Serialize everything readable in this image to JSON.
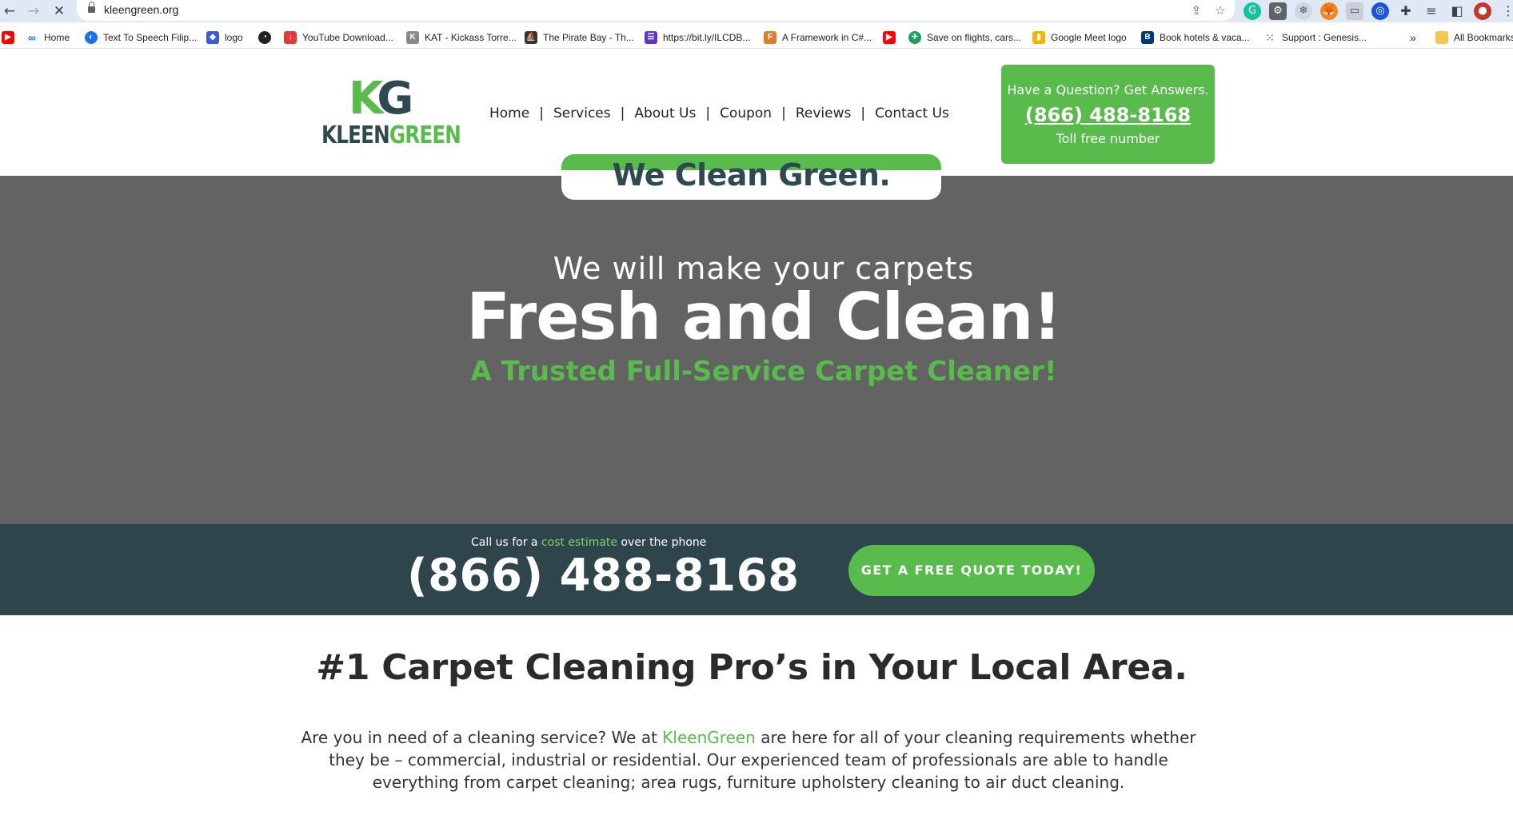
{
  "browser": {
    "url": "kleengreen.org",
    "bookmarks": [
      {
        "label": "Home",
        "icon": "meta-icon",
        "color": "#1877f2"
      },
      {
        "label": "Text To Speech Filip...",
        "icon": "tts-icon",
        "color": "#1a73e8"
      },
      {
        "label": "logo",
        "icon": "shield-logo-icon",
        "color": "#3b5bdb"
      },
      {
        "label": "",
        "icon": "globe-icon",
        "color": "#202124"
      },
      {
        "label": "YouTube Download...",
        "icon": "download-icon",
        "color": "#e53935"
      },
      {
        "label": "KAT - Kickass Torre...",
        "icon": "kat-icon",
        "color": "#6d6d6d"
      },
      {
        "label": "The Pirate Bay - Th...",
        "icon": "pirate-ship-icon",
        "color": "#333333"
      },
      {
        "label": "https://bit.ly/ILCDB...",
        "icon": "list-icon",
        "color": "#5c35cc"
      },
      {
        "label": "A Framework in C#...",
        "icon": "framework-icon",
        "color": "#d9822b"
      },
      {
        "label": "",
        "icon": "youtube-icon",
        "color": "#ff0000"
      },
      {
        "label": "Save on flights, cars...",
        "icon": "plane-icon",
        "color": "#1e9e57"
      },
      {
        "label": "Google Meet logo",
        "icon": "meet-icon",
        "color": "#f4b400"
      },
      {
        "label": "Book hotels & vaca...",
        "icon": "booking-icon",
        "color": "#003580"
      },
      {
        "label": "Support : Genesis...",
        "icon": "dots-grid-icon",
        "color": "#888888"
      }
    ],
    "all_bookmarks_label": "All Bookmarks",
    "more_chevron": "»"
  },
  "header": {
    "logo_monogram_k": "K",
    "logo_monogram_g": "G",
    "logo_word_kleen": "KLEEN",
    "logo_word_green": "GREEN",
    "nav": [
      "Home",
      "Services",
      "About Us",
      "Coupon",
      "Reviews",
      "Contact Us"
    ],
    "nav_separator": "|",
    "question": {
      "prompt": "Have a Question? Get Answers.",
      "phone": "(866) 488-8168",
      "note": "Toll free number"
    }
  },
  "hero": {
    "pill_label": "We Clean Green.",
    "subtitle": "We will make your carpets",
    "title": "Fresh and Clean!",
    "tagline": "A Trusted Full-Service Carpet Cleaner!"
  },
  "callband": {
    "intro_before": "Call us for a",
    "intro_highlight": "cost estimate",
    "intro_after": "over the phone",
    "phone": "(866) 488-8168",
    "cta": "GET A FREE QUOTE TODAY!"
  },
  "content": {
    "title": "#1 Carpet Cleaning Pro’s in Your Local Area.",
    "body_before": "Are you in need of a cleaning service? We at",
    "body_brand": "KleenGreen",
    "body_after": "are here for all of your cleaning requirements whether they be – commercial, industrial or residential. Our experienced team of professionals are able to handle everything from carpet cleaning; area rugs, furniture upholstery cleaning to air duct cleaning."
  },
  "colors": {
    "brand_green": "#58bb4c",
    "brand_dark": "#2f4a4f",
    "hero_gray": "#636363",
    "band_dark": "#2e454b"
  }
}
